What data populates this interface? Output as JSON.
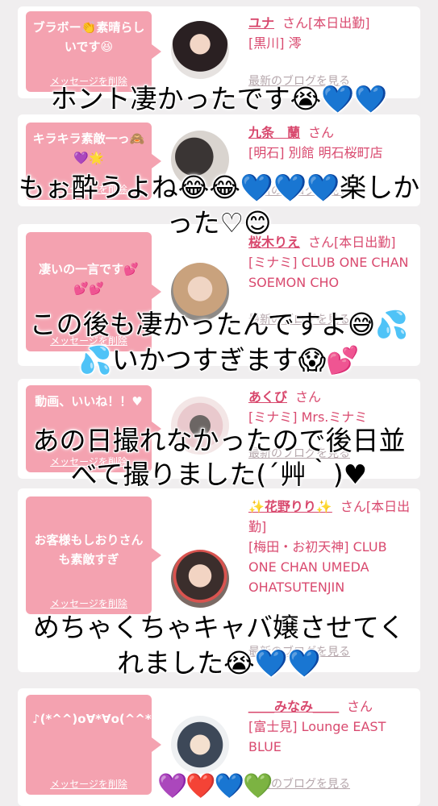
{
  "cards": [
    {
      "message": "ブラボー👏素晴らしいです😆",
      "delete_label": "メッセージを削除",
      "name": "ユナ",
      "san": "さん[本日出勤]",
      "store": "[黒川] 澪",
      "blog": "最新のブログを見る"
    },
    {
      "message": "キラキラ素敵一っ🙈💜🌟",
      "delete_label": "メッセージを削除",
      "name": "九条　蘭",
      "san": "さん",
      "store": "[明石] 別館 明石桜町店",
      "blog": "最新のブログを見る"
    },
    {
      "message": "凄いの一言です💕💕💕",
      "delete_label": "メッセージを削除",
      "name": "桜木りえ",
      "san": "さん[本日出勤]",
      "store": "[ミナミ] CLUB ONE CHAN SOEMON CHO",
      "blog": "最新のブログを見る"
    },
    {
      "message": "動画、いいね！！♥",
      "delete_label": "メッセージを削除",
      "name": "あくび",
      "san": "さん",
      "store": "[ミナミ] Mrs.ミナミ",
      "blog": "最新のブログを見る"
    },
    {
      "message": "お客様もしおりさんも素敵すぎ",
      "delete_label": "メッセージを削除",
      "name": "✨花野りり✨",
      "san": "さん[本日出勤]",
      "store": "[梅田・お初天神] CLUB ONE CHAN UMEDA OHATSUTENJIN",
      "blog": "最新のブログを見る"
    },
    {
      "message": "♪(*^^)o∀*∀o(^^*)",
      "delete_label": "メッセージを削除",
      "name": "＿＿みなみ＿＿",
      "san": "さん",
      "store": "[富士見] Lounge EAST BLUE",
      "blog": "最新のブログを見る"
    }
  ],
  "overlay": {
    "line1": "ホント凄かったです😭💙💙",
    "line2": "もぉ酔うよね😂😂💙💙💙楽しか",
    "line3": "った♡😊",
    "line4": "この後も凄かったんですよ😅💦",
    "line5": "💦いかつすぎます😱💕",
    "line6": "あの日撮れなかったので後日並",
    "line7": "べて撮りました(´艸｀)♥",
    "line8": "めちゃくちゃキャバ嬢させてく",
    "line9": "れました😭💙💙",
    "hearts": "💜❤️💙💚"
  }
}
